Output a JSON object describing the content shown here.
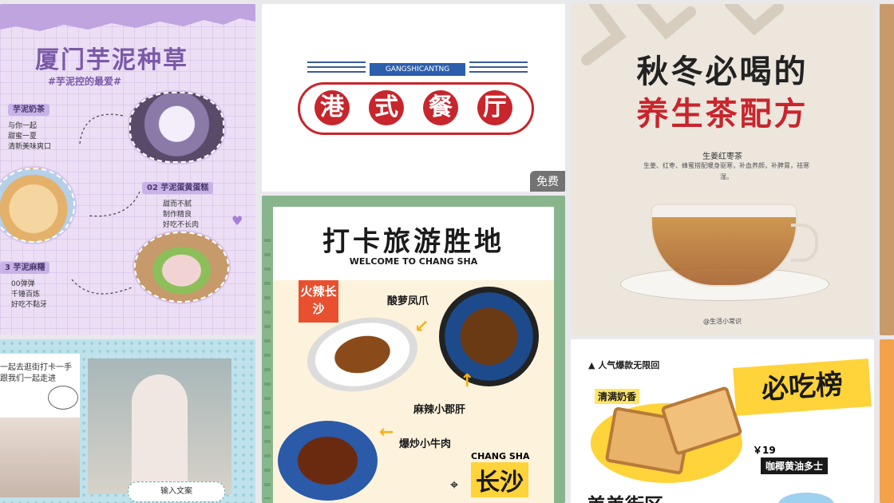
{
  "taro": {
    "title": "厦门芋泥种草",
    "subtitle": "#芋泥控的最爱#",
    "item1": {
      "tag": "芋泥奶茶",
      "desc1": "与你一起",
      "desc2": "甜蜜一夏",
      "desc3": "清新美味爽口"
    },
    "item2": {
      "tag": "02 芋泥蛋黄蛋糕",
      "desc1": "甜而不腻",
      "desc2": "制作精良",
      "desc3": "好吃不长肉"
    },
    "item3": {
      "tag": "3 芋泥麻糬",
      "desc1": "00弹弹",
      "desc2": "千锤百炼",
      "desc3": "好吃不黏牙"
    }
  },
  "hk": {
    "pinyin": "GANGSHICANTNG",
    "chars": [
      "港",
      "式",
      "餐",
      "厅"
    ],
    "badge": "免费"
  },
  "tea": {
    "title1": "秋冬必喝的",
    "title2": "养生茶配方",
    "heading": "生姜红枣茶",
    "desc": "生姜、红枣、蜂蜜搭配暖身驱寒，补血养颜，补脾胃，祛寒湿。",
    "credit": "@生活小常识"
  },
  "cs": {
    "title": "打卡旅游胜地",
    "subtitle": "WELCOME TO CHANG SHA",
    "badge": "火辣长沙",
    "dish1": "酸萝凤爪",
    "dish2": "麻辣小郡肝",
    "dish3": "爆炒小牛肉",
    "city_en": "CHANG SHA",
    "city_cn": "长沙"
  },
  "pink": {
    "caption": "一起去逛街打卡一手",
    "caption2": "跟我们一起走进",
    "sticker": "输入文案"
  },
  "must": {
    "tag": "▲ 人气爆款无限回",
    "title": "必吃榜",
    "milk": "清满奶香",
    "price": "￥19",
    "name": "咖椰黄油多士",
    "bottom": "美美街区"
  },
  "colors": {
    "accent_red": "#c8252c",
    "purple": "#7a5aa8",
    "green": "#88b58c",
    "yellow": "#ffd33a"
  }
}
